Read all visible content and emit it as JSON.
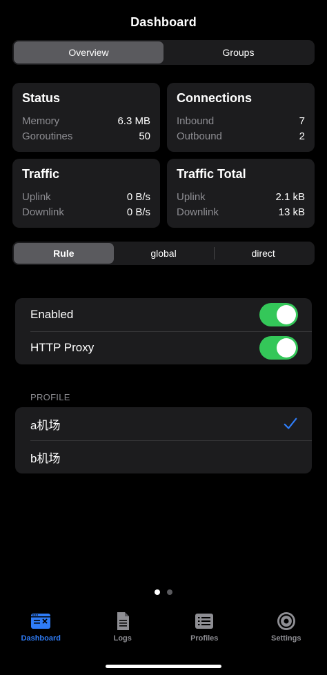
{
  "title": "Dashboard",
  "top_segment": {
    "items": [
      "Overview",
      "Groups"
    ],
    "selected": 0
  },
  "status": {
    "title": "Status",
    "rows": [
      {
        "k": "Memory",
        "v": "6.3 MB"
      },
      {
        "k": "Goroutines",
        "v": "50"
      }
    ]
  },
  "connections": {
    "title": "Connections",
    "rows": [
      {
        "k": "Inbound",
        "v": "7"
      },
      {
        "k": "Outbound",
        "v": "2"
      }
    ]
  },
  "traffic": {
    "title": "Traffic",
    "rows": [
      {
        "k": "Uplink",
        "v": "0 B/s"
      },
      {
        "k": "Downlink",
        "v": "0 B/s"
      }
    ]
  },
  "traffic_total": {
    "title": "Traffic Total",
    "rows": [
      {
        "k": "Uplink",
        "v": "2.1 kB"
      },
      {
        "k": "Downlink",
        "v": "13 kB"
      }
    ]
  },
  "mode_segment": {
    "items": [
      "Rule",
      "global",
      "direct"
    ],
    "selected": 0
  },
  "toggles": [
    {
      "label": "Enabled",
      "on": true
    },
    {
      "label": "HTTP Proxy",
      "on": true
    }
  ],
  "profile": {
    "header": "PROFILE",
    "items": [
      {
        "label": "a机场",
        "checked": true
      },
      {
        "label": "b机场",
        "checked": false
      }
    ]
  },
  "colors": {
    "accent": "#2f7cf6",
    "toggle_on": "#34c759",
    "card_bg": "#1c1c1e"
  },
  "page_indicator": {
    "count": 2,
    "current": 1
  },
  "tabs": [
    {
      "label": "Dashboard",
      "icon": "dashboard-icon",
      "active": true
    },
    {
      "label": "Logs",
      "icon": "logs-icon",
      "active": false
    },
    {
      "label": "Profiles",
      "icon": "profiles-icon",
      "active": false
    },
    {
      "label": "Settings",
      "icon": "settings-icon",
      "active": false
    }
  ]
}
